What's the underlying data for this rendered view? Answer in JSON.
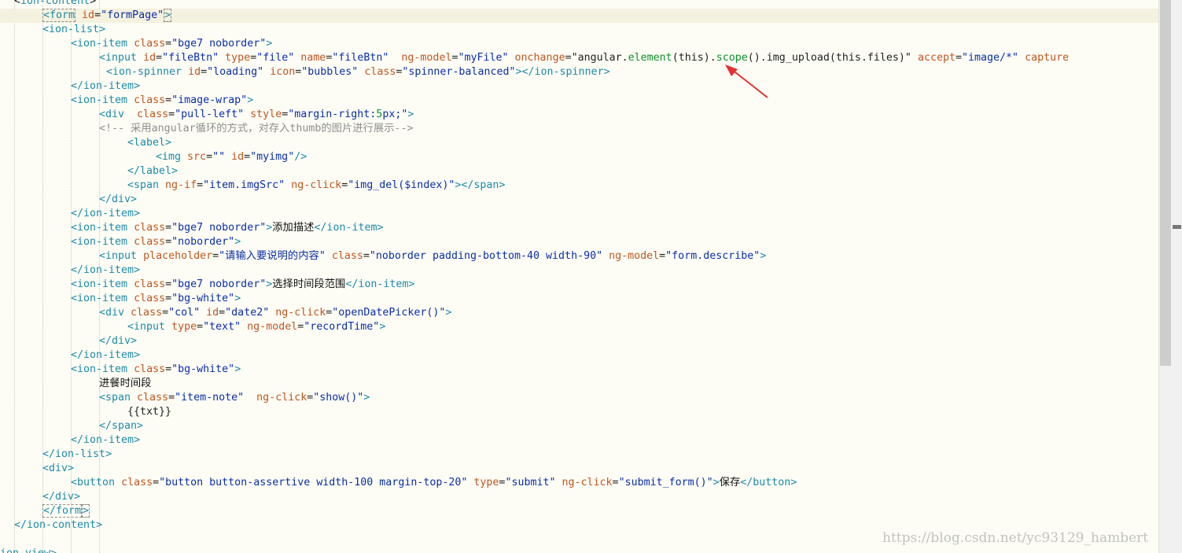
{
  "code_lines": [
    {
      "indent": 1,
      "highlight": false,
      "tokens": [
        [
          "p",
          "<"
        ],
        [
          "t",
          "ion-content"
        ],
        [
          "p",
          ">"
        ]
      ]
    },
    {
      "indent": 3,
      "highlight": true,
      "tokens": [
        [
          "t",
          "<form"
        ],
        [
          "p",
          " "
        ],
        [
          "a",
          "id"
        ],
        [
          "p",
          "="
        ],
        [
          "s",
          "\"formPage\""
        ],
        [
          "t",
          ">"
        ]
      ]
    },
    {
      "indent": 3,
      "highlight": false,
      "tokens": [
        [
          "t",
          "<ion-list"
        ],
        [
          "t",
          ">"
        ]
      ]
    },
    {
      "indent": 5,
      "highlight": false,
      "tokens": [
        [
          "t",
          "<ion-item"
        ],
        [
          "p",
          " "
        ],
        [
          "a",
          "class"
        ],
        [
          "p",
          "="
        ],
        [
          "s",
          "\"bge7 noborder\""
        ],
        [
          "t",
          ">"
        ]
      ]
    },
    {
      "indent": 7,
      "highlight": false,
      "tokens": [
        [
          "t",
          "<input"
        ],
        [
          "p",
          " "
        ],
        [
          "a",
          "id"
        ],
        [
          "p",
          "="
        ],
        [
          "s",
          "\"fileBtn\""
        ],
        [
          "p",
          " "
        ],
        [
          "a",
          "type"
        ],
        [
          "p",
          "="
        ],
        [
          "s",
          "\"file\""
        ],
        [
          "p",
          " "
        ],
        [
          "a",
          "name"
        ],
        [
          "p",
          "="
        ],
        [
          "s",
          "\"fileBtn\""
        ],
        [
          "p",
          "  "
        ],
        [
          "a",
          "ng-model"
        ],
        [
          "p",
          "="
        ],
        [
          "s",
          "\"myFile\""
        ],
        [
          "p",
          " "
        ],
        [
          "a",
          "onchange"
        ],
        [
          "p",
          "=\""
        ],
        [
          "p",
          "angular."
        ],
        [
          "n",
          "element"
        ],
        [
          "p",
          "(this)."
        ],
        [
          "n",
          "scope"
        ],
        [
          "p",
          "()."
        ],
        [
          "p",
          "img_upload(this.files)"
        ],
        [
          "p",
          "\""
        ],
        [
          "p",
          " "
        ],
        [
          "a",
          "accept"
        ],
        [
          "p",
          "="
        ],
        [
          "s",
          "\"image/*\""
        ],
        [
          "p",
          " "
        ],
        [
          "a",
          "capture"
        ]
      ]
    },
    {
      "indent": 7.5,
      "highlight": false,
      "tokens": [
        [
          "t",
          "<ion-spinner"
        ],
        [
          "p",
          " "
        ],
        [
          "a",
          "id"
        ],
        [
          "p",
          "="
        ],
        [
          "s",
          "\"loading\""
        ],
        [
          "p",
          " "
        ],
        [
          "a",
          "icon"
        ],
        [
          "p",
          "="
        ],
        [
          "s",
          "\"bubbles\""
        ],
        [
          "p",
          " "
        ],
        [
          "a",
          "class"
        ],
        [
          "p",
          "="
        ],
        [
          "s",
          "\"spinner-balanced\""
        ],
        [
          "t",
          ">"
        ],
        [
          "t",
          "</ion-spinner"
        ],
        [
          "t",
          ">"
        ]
      ]
    },
    {
      "indent": 5,
      "highlight": false,
      "tokens": [
        [
          "t",
          "</ion-item"
        ],
        [
          "t",
          ">"
        ]
      ]
    },
    {
      "indent": 5,
      "highlight": false,
      "tokens": [
        [
          "t",
          "<ion-item"
        ],
        [
          "p",
          " "
        ],
        [
          "a",
          "class"
        ],
        [
          "p",
          "="
        ],
        [
          "s",
          "\"image-wrap\""
        ],
        [
          "t",
          ">"
        ]
      ]
    },
    {
      "indent": 7,
      "highlight": false,
      "tokens": [
        [
          "t",
          "<div"
        ],
        [
          "p",
          "  "
        ],
        [
          "a",
          "class"
        ],
        [
          "p",
          "="
        ],
        [
          "s",
          "\"pull-left\""
        ],
        [
          "p",
          " "
        ],
        [
          "a",
          "style"
        ],
        [
          "p",
          "="
        ],
        [
          "s",
          "\"margin-right:"
        ],
        [
          "n",
          "5"
        ],
        [
          "s",
          "px;\""
        ],
        [
          "t",
          ">"
        ]
      ]
    },
    {
      "indent": 7,
      "highlight": false,
      "tokens": [
        [
          "c",
          "<!-- 采用angular循环的方式，对存入thumb的图片进行展示-->"
        ]
      ]
    },
    {
      "indent": 9,
      "highlight": false,
      "tokens": [
        [
          "t",
          "<label"
        ],
        [
          "t",
          ">"
        ]
      ]
    },
    {
      "indent": 11,
      "highlight": false,
      "tokens": [
        [
          "t",
          "<img"
        ],
        [
          "p",
          " "
        ],
        [
          "a",
          "src"
        ],
        [
          "p",
          "="
        ],
        [
          "s",
          "\"\""
        ],
        [
          "p",
          " "
        ],
        [
          "a",
          "id"
        ],
        [
          "p",
          "="
        ],
        [
          "s",
          "\"myimg\""
        ],
        [
          "t",
          "/>"
        ]
      ]
    },
    {
      "indent": 9,
      "highlight": false,
      "tokens": [
        [
          "t",
          "</label"
        ],
        [
          "t",
          ">"
        ]
      ]
    },
    {
      "indent": 9,
      "highlight": false,
      "tokens": [
        [
          "t",
          "<span"
        ],
        [
          "p",
          " "
        ],
        [
          "a",
          "ng-if"
        ],
        [
          "p",
          "="
        ],
        [
          "s",
          "\"item.imgSrc\""
        ],
        [
          "p",
          " "
        ],
        [
          "a",
          "ng-click"
        ],
        [
          "p",
          "="
        ],
        [
          "s",
          "\"img_del($index)\""
        ],
        [
          "t",
          ">"
        ],
        [
          "t",
          "</span"
        ],
        [
          "t",
          ">"
        ]
      ]
    },
    {
      "indent": 7,
      "highlight": false,
      "tokens": [
        [
          "t",
          "</div"
        ],
        [
          "t",
          ">"
        ]
      ]
    },
    {
      "indent": 5,
      "highlight": false,
      "tokens": [
        [
          "t",
          "</ion-item"
        ],
        [
          "t",
          ">"
        ]
      ]
    },
    {
      "indent": 5,
      "highlight": false,
      "tokens": [
        [
          "t",
          "<ion-item"
        ],
        [
          "p",
          " "
        ],
        [
          "a",
          "class"
        ],
        [
          "p",
          "="
        ],
        [
          "s",
          "\"bge7 noborder\""
        ],
        [
          "t",
          ">"
        ],
        [
          "x",
          "添加描述"
        ],
        [
          "t",
          "</ion-item"
        ],
        [
          "t",
          ">"
        ]
      ]
    },
    {
      "indent": 5,
      "highlight": false,
      "tokens": [
        [
          "t",
          "<ion-item"
        ],
        [
          "p",
          " "
        ],
        [
          "a",
          "class"
        ],
        [
          "p",
          "="
        ],
        [
          "s",
          "\"noborder\""
        ],
        [
          "t",
          ">"
        ]
      ]
    },
    {
      "indent": 7,
      "highlight": false,
      "tokens": [
        [
          "t",
          "<input"
        ],
        [
          "p",
          " "
        ],
        [
          "a",
          "placeholder"
        ],
        [
          "p",
          "="
        ],
        [
          "s",
          "\"请输入要说明的内容\""
        ],
        [
          "p",
          " "
        ],
        [
          "a",
          "class"
        ],
        [
          "p",
          "="
        ],
        [
          "s",
          "\"noborder padding-bottom-40 width-90\""
        ],
        [
          "p",
          " "
        ],
        [
          "a",
          "ng-model"
        ],
        [
          "p",
          "="
        ],
        [
          "s",
          "\"form.describe\""
        ],
        [
          "t",
          ">"
        ]
      ]
    },
    {
      "indent": 5,
      "highlight": false,
      "tokens": [
        [
          "t",
          "</ion-item"
        ],
        [
          "t",
          ">"
        ]
      ]
    },
    {
      "indent": 5,
      "highlight": false,
      "tokens": [
        [
          "t",
          "<ion-item"
        ],
        [
          "p",
          " "
        ],
        [
          "a",
          "class"
        ],
        [
          "p",
          "="
        ],
        [
          "s",
          "\"bge7 noborder\""
        ],
        [
          "t",
          ">"
        ],
        [
          "x",
          "选择时间段范围"
        ],
        [
          "t",
          "</ion-item"
        ],
        [
          "t",
          ">"
        ]
      ]
    },
    {
      "indent": 5,
      "highlight": false,
      "tokens": [
        [
          "t",
          "<ion-item"
        ],
        [
          "p",
          " "
        ],
        [
          "a",
          "class"
        ],
        [
          "p",
          "="
        ],
        [
          "s",
          "\"bg-white\""
        ],
        [
          "t",
          ">"
        ]
      ]
    },
    {
      "indent": 7,
      "highlight": false,
      "tokens": [
        [
          "t",
          "<div"
        ],
        [
          "p",
          " "
        ],
        [
          "a",
          "class"
        ],
        [
          "p",
          "="
        ],
        [
          "s",
          "\"col\""
        ],
        [
          "p",
          " "
        ],
        [
          "a",
          "id"
        ],
        [
          "p",
          "="
        ],
        [
          "s",
          "\"date2\""
        ],
        [
          "p",
          " "
        ],
        [
          "a",
          "ng-click"
        ],
        [
          "p",
          "="
        ],
        [
          "s",
          "\"openDatePicker()\""
        ],
        [
          "t",
          ">"
        ]
      ]
    },
    {
      "indent": 9,
      "highlight": false,
      "tokens": [
        [
          "t",
          "<input"
        ],
        [
          "p",
          " "
        ],
        [
          "a",
          "type"
        ],
        [
          "p",
          "="
        ],
        [
          "s",
          "\"text\""
        ],
        [
          "p",
          " "
        ],
        [
          "a",
          "ng-model"
        ],
        [
          "p",
          "="
        ],
        [
          "s",
          "\"recordTime\""
        ],
        [
          "t",
          ">"
        ]
      ]
    },
    {
      "indent": 7,
      "highlight": false,
      "tokens": [
        [
          "t",
          "</div"
        ],
        [
          "t",
          ">"
        ]
      ]
    },
    {
      "indent": 5,
      "highlight": false,
      "tokens": [
        [
          "t",
          "</ion-item"
        ],
        [
          "t",
          ">"
        ]
      ]
    },
    {
      "indent": 5,
      "highlight": false,
      "tokens": [
        [
          "t",
          "<ion-item"
        ],
        [
          "p",
          " "
        ],
        [
          "a",
          "class"
        ],
        [
          "p",
          "="
        ],
        [
          "s",
          "\"bg-white\""
        ],
        [
          "t",
          ">"
        ]
      ]
    },
    {
      "indent": 7,
      "highlight": false,
      "tokens": [
        [
          "x",
          "进餐时间段"
        ]
      ]
    },
    {
      "indent": 7,
      "highlight": false,
      "tokens": [
        [
          "t",
          "<span"
        ],
        [
          "p",
          " "
        ],
        [
          "a",
          "class"
        ],
        [
          "p",
          "="
        ],
        [
          "s",
          "\"item-note\""
        ],
        [
          "p",
          "  "
        ],
        [
          "a",
          "ng-click"
        ],
        [
          "p",
          "="
        ],
        [
          "s",
          "\"show()\""
        ],
        [
          "t",
          ">"
        ]
      ]
    },
    {
      "indent": 9,
      "highlight": false,
      "tokens": [
        [
          "p",
          "{{txt}}"
        ]
      ]
    },
    {
      "indent": 7,
      "highlight": false,
      "tokens": [
        [
          "t",
          "</span"
        ],
        [
          "t",
          ">"
        ]
      ]
    },
    {
      "indent": 5,
      "highlight": false,
      "tokens": [
        [
          "t",
          "</ion-item"
        ],
        [
          "t",
          ">"
        ]
      ]
    },
    {
      "indent": 3,
      "highlight": false,
      "tokens": [
        [
          "t",
          "</ion-list"
        ],
        [
          "t",
          ">"
        ]
      ]
    },
    {
      "indent": 3,
      "highlight": false,
      "tokens": [
        [
          "t",
          "<div"
        ],
        [
          "t",
          ">"
        ]
      ]
    },
    {
      "indent": 5,
      "highlight": false,
      "tokens": [
        [
          "t",
          "<button"
        ],
        [
          "p",
          " "
        ],
        [
          "a",
          "class"
        ],
        [
          "p",
          "="
        ],
        [
          "s",
          "\"button button-assertive width-100 margin-top-20\""
        ],
        [
          "p",
          " "
        ],
        [
          "a",
          "type"
        ],
        [
          "p",
          "="
        ],
        [
          "s",
          "\"submit\""
        ],
        [
          "p",
          " "
        ],
        [
          "a",
          "ng-click"
        ],
        [
          "p",
          "="
        ],
        [
          "s",
          "\"submit_form()\""
        ],
        [
          "t",
          ">"
        ],
        [
          "x",
          "保存"
        ],
        [
          "t",
          "</button"
        ],
        [
          "t",
          ">"
        ]
      ]
    },
    {
      "indent": 3,
      "highlight": false,
      "tokens": [
        [
          "t",
          "</div"
        ],
        [
          "t",
          ">"
        ]
      ]
    },
    {
      "indent": 3,
      "highlight": false,
      "tokens": [
        [
          "t",
          "</form"
        ],
        [
          "t",
          ">"
        ]
      ]
    },
    {
      "indent": 1,
      "highlight": false,
      "tokens": [
        [
          "t",
          "</ion-content"
        ],
        [
          "t",
          ">"
        ]
      ]
    },
    {
      "indent": 0,
      "highlight": false,
      "tokens": []
    },
    {
      "indent": 0,
      "highlight": false,
      "tokens": [
        [
          "t",
          "ion-view"
        ],
        [
          "t",
          ">"
        ]
      ]
    }
  ],
  "watermark": "https://blog.csdn.net/yc93129_hambert",
  "colors": {
    "tag": "#1d8aa8",
    "attr": "#c0561e",
    "string": "#0a2ea6",
    "number": "#0d8f2a",
    "comment": "#8e8e8e",
    "arrow": "#e53030"
  }
}
